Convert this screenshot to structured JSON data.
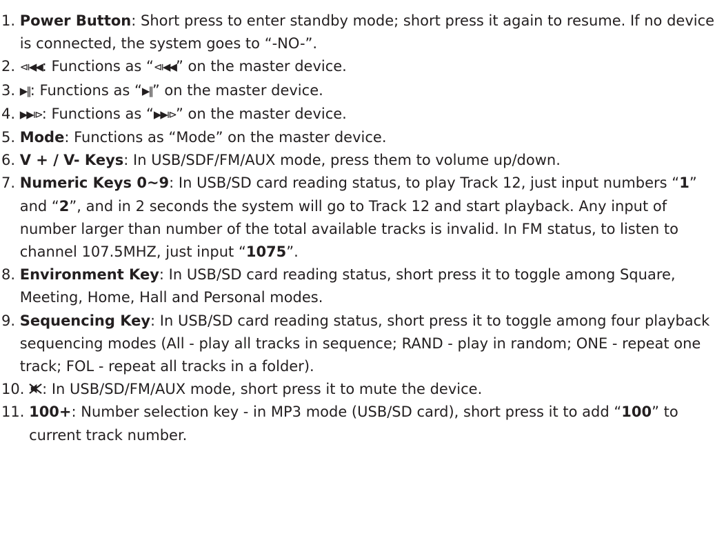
{
  "items": [
    {
      "num": "1. ",
      "term": "Power Button",
      "text": ": Short press to enter standby mode;  short press it again to resume. If no device is connected, the system goes to “-NO-”."
    },
    {
      "num": "2. ",
      "sym": "⧏◀◀",
      "text_a": ": Functions as “",
      "text_b": "” on the master device."
    },
    {
      "num": "3. ",
      "sym": "▶‖",
      "text_a": ": Functions as “",
      "text_b": "” on the master device."
    },
    {
      "num": "4. ",
      "sym": "▶▶⧐",
      "text_a": ": Functions as “",
      "text_b": "” on the master device."
    },
    {
      "num": "5. ",
      "term": "Mode",
      "text": ": Functions as “Mode” on the master device."
    },
    {
      "num": "6. ",
      "term": "V + / V- Keys",
      "text": ": In USB/SDF/FM/AUX mode, press them to volume up/down."
    },
    {
      "num": "7. ",
      "term": "Numeric Keys 0~9",
      "t1": ": In USB/SD card reading status, to play Track 12, just input numbers “",
      "b1": "1",
      "t2": "” and “",
      "b2": "2",
      "t3": "”, and in 2 seconds the system will go to Track 12 and start playback. Any input of number larger than number of the total available tracks is invalid. In FM status, to listen to channel 107.5MHZ, just input “",
      "b3": "1075",
      "t4": "”."
    },
    {
      "num": "8. ",
      "term": "Environment Key",
      "text": ": In USB/SD card reading status, short press it to toggle among Square, Meeting, Home, Hall and Personal modes."
    },
    {
      "num": "9. ",
      "term": "Sequencing Key",
      "text": ": In USB/SD card reading status, short press it to toggle among four playback sequencing modes (All - play all tracks in sequence; RAND - play in random; ONE - repeat one track; FOL - repeat all tracks in a folder)."
    },
    {
      "num": "10. ",
      "icon": "mute-icon",
      "text": ": In USB/SD/FM/AUX mode, short press it to mute the device."
    },
    {
      "num": "11. ",
      "term": "100+",
      "t1": ": Number selection key - in MP3 mode (USB/SD card), short press it to add “",
      "b1": "100",
      "t2": "” to current track number."
    }
  ]
}
